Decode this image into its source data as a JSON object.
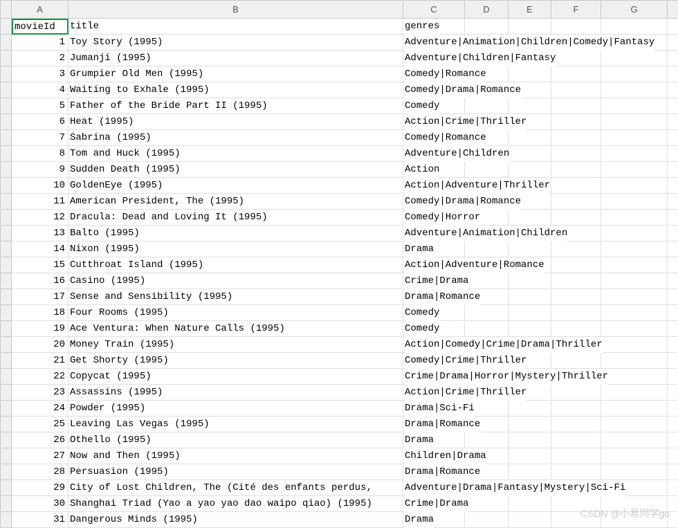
{
  "columns": [
    "A",
    "B",
    "C",
    "D",
    "E",
    "F",
    "G"
  ],
  "header_row": {
    "A": "movieId",
    "B": "title",
    "C": "genres"
  },
  "watermark": "CSDN @小易同学go",
  "rows": [
    {
      "id": "1",
      "title": "Toy Story (1995)",
      "genres": "Adventure|Animation|Children|Comedy|Fantasy"
    },
    {
      "id": "2",
      "title": "Jumanji (1995)",
      "genres": "Adventure|Children|Fantasy"
    },
    {
      "id": "3",
      "title": "Grumpier Old Men (1995)",
      "genres": "Comedy|Romance"
    },
    {
      "id": "4",
      "title": "Waiting to Exhale (1995)",
      "genres": "Comedy|Drama|Romance"
    },
    {
      "id": "5",
      "title": "Father of the Bride Part II (1995)",
      "genres": "Comedy"
    },
    {
      "id": "6",
      "title": "Heat (1995)",
      "genres": "Action|Crime|Thriller"
    },
    {
      "id": "7",
      "title": "Sabrina (1995)",
      "genres": "Comedy|Romance"
    },
    {
      "id": "8",
      "title": "Tom and Huck (1995)",
      "genres": "Adventure|Children"
    },
    {
      "id": "9",
      "title": "Sudden Death (1995)",
      "genres": "Action"
    },
    {
      "id": "10",
      "title": "GoldenEye (1995)",
      "genres": "Action|Adventure|Thriller"
    },
    {
      "id": "11",
      "title": "American President, The (1995)",
      "genres": "Comedy|Drama|Romance"
    },
    {
      "id": "12",
      "title": "Dracula: Dead and Loving It (1995)",
      "genres": "Comedy|Horror"
    },
    {
      "id": "13",
      "title": "Balto (1995)",
      "genres": "Adventure|Animation|Children"
    },
    {
      "id": "14",
      "title": "Nixon (1995)",
      "genres": "Drama"
    },
    {
      "id": "15",
      "title": "Cutthroat Island (1995)",
      "genres": "Action|Adventure|Romance"
    },
    {
      "id": "16",
      "title": "Casino (1995)",
      "genres": "Crime|Drama"
    },
    {
      "id": "17",
      "title": "Sense and Sensibility (1995)",
      "genres": "Drama|Romance"
    },
    {
      "id": "18",
      "title": "Four Rooms (1995)",
      "genres": "Comedy"
    },
    {
      "id": "19",
      "title": "Ace Ventura: When Nature Calls (1995)",
      "genres": "Comedy"
    },
    {
      "id": "20",
      "title": "Money Train (1995)",
      "genres": "Action|Comedy|Crime|Drama|Thriller"
    },
    {
      "id": "21",
      "title": "Get Shorty (1995)",
      "genres": "Comedy|Crime|Thriller"
    },
    {
      "id": "22",
      "title": "Copycat (1995)",
      "genres": "Crime|Drama|Horror|Mystery|Thriller"
    },
    {
      "id": "23",
      "title": "Assassins (1995)",
      "genres": "Action|Crime|Thriller"
    },
    {
      "id": "24",
      "title": "Powder (1995)",
      "genres": "Drama|Sci-Fi"
    },
    {
      "id": "25",
      "title": "Leaving Las Vegas (1995)",
      "genres": "Drama|Romance"
    },
    {
      "id": "26",
      "title": "Othello (1995)",
      "genres": "Drama"
    },
    {
      "id": "27",
      "title": "Now and Then (1995)",
      "genres": "Children|Drama"
    },
    {
      "id": "28",
      "title": "Persuasion (1995)",
      "genres": "Drama|Romance"
    },
    {
      "id": "29",
      "title": "City of Lost Children, The (Cité des enfants perdus,",
      "genres": "Adventure|Drama|Fantasy|Mystery|Sci-Fi"
    },
    {
      "id": "30",
      "title": "Shanghai Triad (Yao a yao yao dao waipo qiao) (1995)",
      "genres": "Crime|Drama"
    },
    {
      "id": "31",
      "title": "Dangerous Minds (1995)",
      "genres": "Drama"
    }
  ]
}
